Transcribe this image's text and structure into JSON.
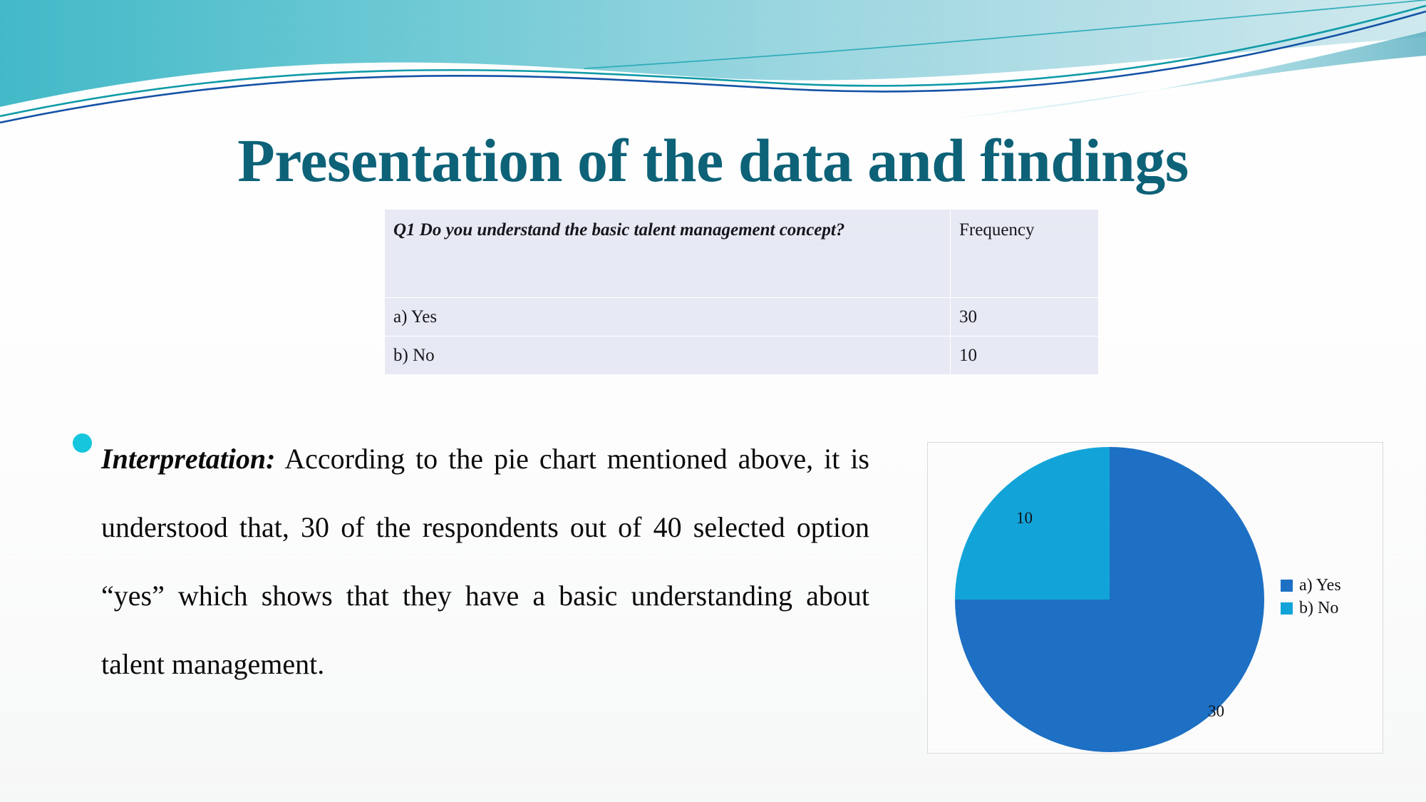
{
  "slide": {
    "title": "Presentation of the data and findings",
    "title_color": "#0d6278",
    "background_color": "#ffffff",
    "decoration": {
      "name": "teal-wave-banner",
      "band_color_left": "#3fb8c8",
      "band_color_right": "#a9dce4",
      "line_color_blue": "#1452a6",
      "line_color_teal": "#0e9ba6"
    }
  },
  "table": {
    "header": {
      "question": "Q1 Do you understand the basic talent management concept?",
      "frequency": "Frequency"
    },
    "rows": [
      {
        "label": "a) Yes",
        "frequency": "30"
      },
      {
        "label": "b) No",
        "frequency": "10"
      }
    ],
    "fill_color": "#e7e9f4"
  },
  "interpretation": {
    "bullet_color": "#15c6dd",
    "lead": "Interpretation:",
    "body": " According to the pie chart mentioned above, it is understood that, 30 of the respondents out of 40 selected option “yes” which shows that they have a basic understanding about talent management."
  },
  "chart_data": {
    "type": "pie",
    "title": "",
    "categories": [
      "a) Yes",
      "b) No"
    ],
    "values": [
      30,
      10
    ],
    "labels": [
      "30",
      "10"
    ],
    "colors": [
      "#1d70c4",
      "#12a4d9"
    ],
    "legend": [
      "a) Yes",
      "b) No"
    ],
    "legend_position": "right",
    "start_angle_deg": 0,
    "direction": "clockwise",
    "total": 40,
    "percentages": [
      75,
      25
    ],
    "grid": false,
    "xlabel": "",
    "ylabel": ""
  }
}
